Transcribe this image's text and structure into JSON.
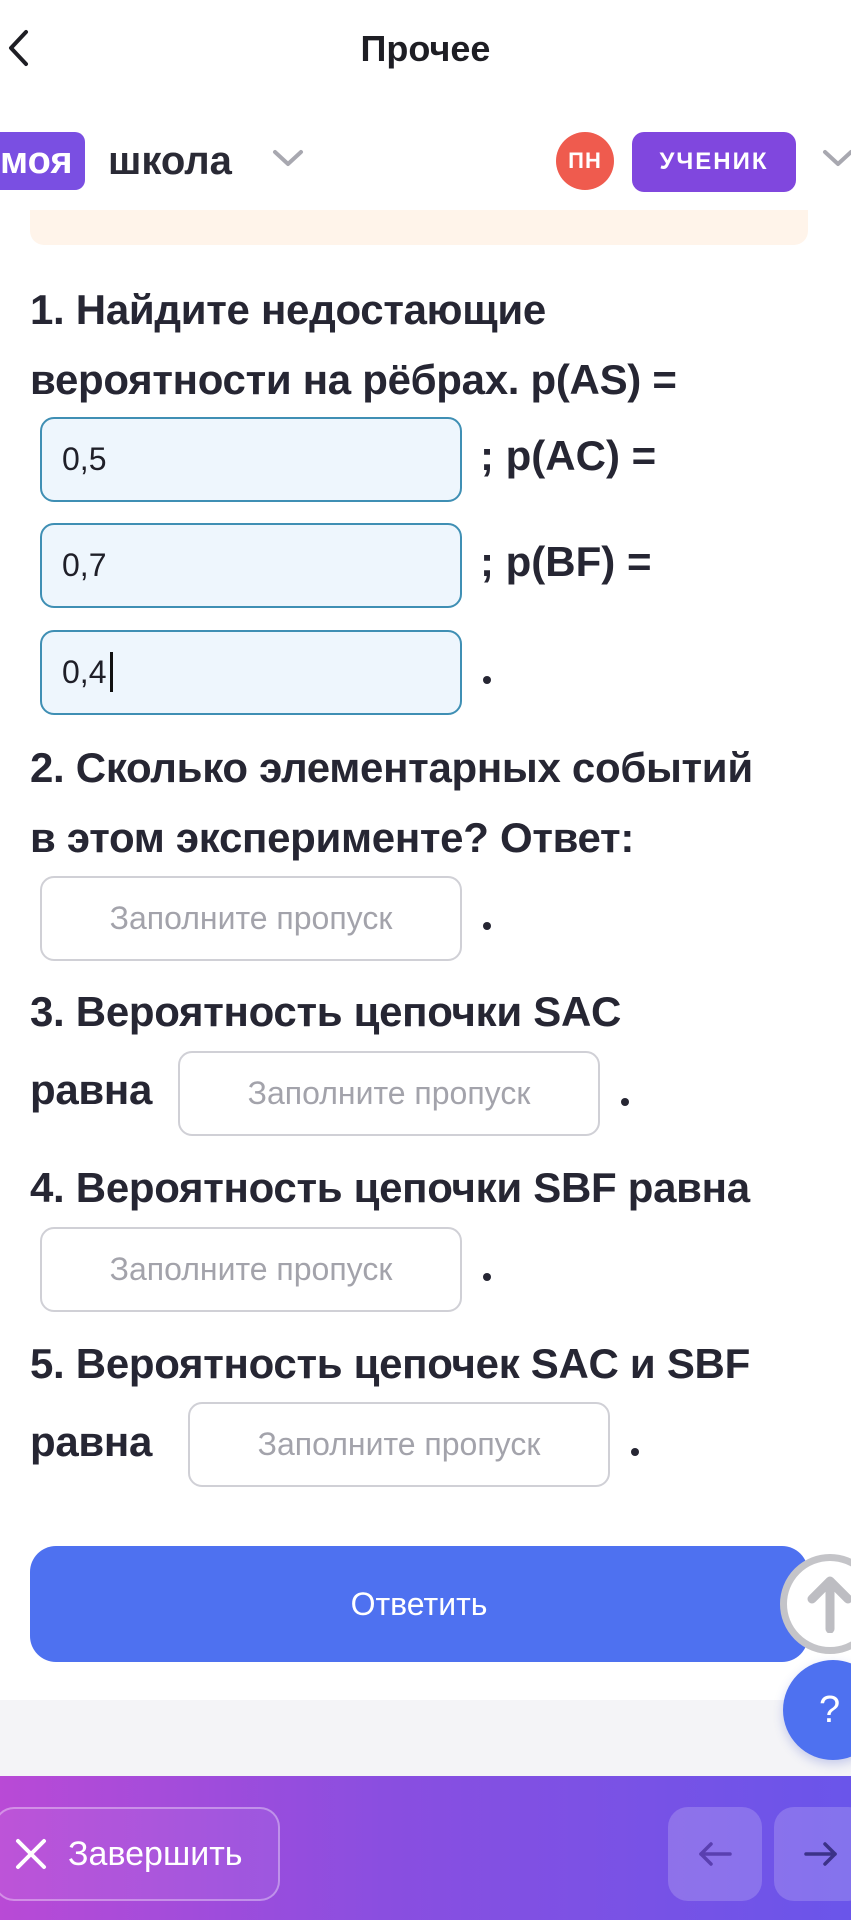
{
  "topbar": {
    "title": "Прочее"
  },
  "header": {
    "logo_box": "моя",
    "logo_text": "школа",
    "avatar_initials": "ПН",
    "role": "УЧЕНИК"
  },
  "questions": {
    "q1": {
      "line1": "1. Найдите недостающие",
      "line2": "вероятности на рёбрах. p(AS) =",
      "after_field1": "; p(AC) =",
      "after_field2": "; p(BF) =",
      "field1_value": "0,5",
      "field2_value": "0,7",
      "field3_value": "0,4"
    },
    "q2": {
      "line1": "2. Сколько элементарных событий",
      "line2": "в этом эксперименте? Ответ:"
    },
    "q3": {
      "line1": "3. Вероятность цепочки SAC",
      "prefix": "равна"
    },
    "q4": {
      "line1": "4. Вероятность цепочки SBF равна"
    },
    "q5": {
      "line1": "5. Вероятность цепочек SAC и SBF",
      "prefix": "равна"
    },
    "placeholder": "Заполните пропуск"
  },
  "submit_label": "Ответить",
  "help_label": "?",
  "bottom": {
    "finish_label": "Завершить"
  },
  "colors": {
    "accent_blue": "#4e71f0",
    "brand_purple": "#7a4fe2",
    "avatar_red": "#ef5b4e",
    "field_border": "#3f8fb4"
  }
}
